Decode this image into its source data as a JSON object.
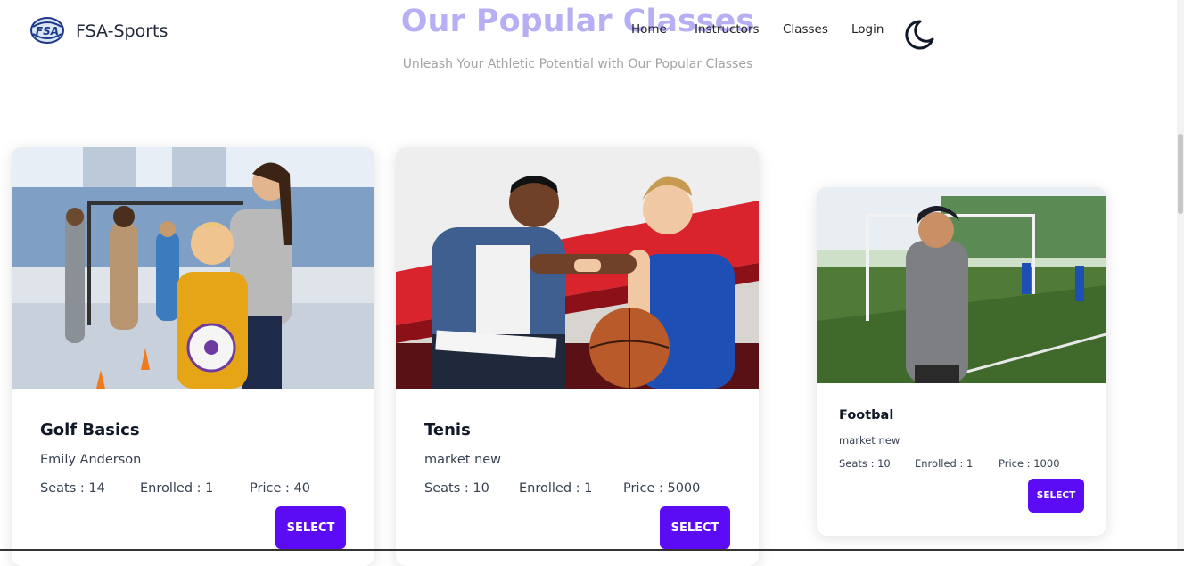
{
  "nav": {
    "logo_text": "FSA",
    "brand": "FSA-Sports",
    "links": [
      "Home",
      "Instructors",
      "Classes",
      "Login"
    ],
    "theme_icon": "moon-icon"
  },
  "section": {
    "heading": "Our Popular Classes",
    "subheading": "Unleash Your Athletic Potential with Our Popular Classes"
  },
  "cards": [
    {
      "title": "Golf Basics",
      "instructor": "Emily Anderson",
      "seats": "Seats : 14",
      "enrolled": "Enrolled : 1",
      "price": "Price : 40",
      "button": "SELECT"
    },
    {
      "title": "Tenis",
      "instructor": "market new",
      "seats": "Seats : 10",
      "enrolled": "Enrolled : 1",
      "price": "Price : 5000",
      "button": "SELECT"
    },
    {
      "title": "Footbal",
      "instructor": "market new",
      "seats": "Seats : 10",
      "enrolled": "Enrolled : 1",
      "price": "Price : 1000",
      "button": "SELECT"
    }
  ],
  "colors": {
    "accent": "#5b0cf5",
    "heading": "#b7aff3"
  }
}
